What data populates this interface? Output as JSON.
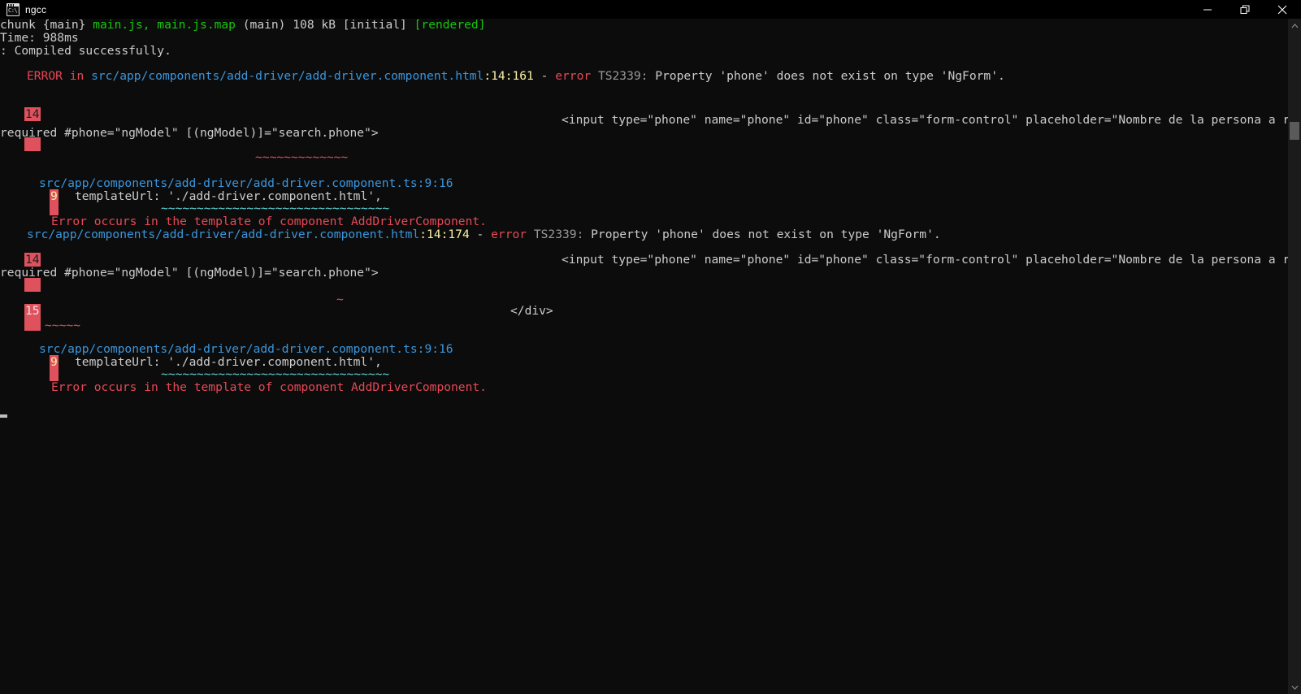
{
  "window": {
    "title": "ngcc",
    "icon": "console-window-icon",
    "controls": [
      {
        "name": "minimize-button",
        "glyph": "minimize"
      },
      {
        "name": "maximize-button",
        "glyph": "restore"
      },
      {
        "name": "close-button",
        "glyph": "close"
      }
    ]
  },
  "colors": {
    "background": "#0c0c0c",
    "titlebar": "#000000",
    "foreground": "#cccccc",
    "green": "#16c60c",
    "cyan": "#3a96dd",
    "teal": "#61d6d6",
    "red": "#e74856",
    "error_block": "#e0515e",
    "yellow": "#f9f1a5",
    "grey": "#9a9a9a",
    "scrollbar_track": "#1b1b1b",
    "scrollbar_thumb": "#5a5a5a"
  },
  "terminal": {
    "build_summary": {
      "chunk_label": "chunk {main} ",
      "chunk_files": "main.js, main.js.map",
      "chunk_meta": " (main) 108 kB [initial] ",
      "chunk_status": "[rendered]",
      "time_line": "Time: 988ms",
      "compiled_line": ": Compiled successfully."
    },
    "errors": [
      {
        "prefix": "ERROR",
        "in_word": " in ",
        "file": "src/app/components/add-driver/add-driver.component.html",
        "location": ":14:161",
        "dash": " - ",
        "error_word": "error",
        "code": " TS2339:",
        "message": " Property 'phone' does not exist on type 'NgForm'.",
        "source_line_number": "14",
        "source_code_left": "required #phone=\"ngModel\" [(ngModel)]=\"search.phone\">",
        "source_code_right": "<input type=\"phone\" name=\"phone\" id=\"phone\" class=\"form-control\" placeholder=\"Nombre de la persona a recoger\"",
        "squiggle": "~~~~~~~~~~~~~",
        "trace_file": "src/app/components/add-driver/add-driver.component.ts:9:16",
        "trace_line_number": "9",
        "trace_code": "templateUrl: './add-driver.component.html',",
        "trace_squiggle": "~~~~~~~~~~~~~~~~~~~~~~~~~~~~~~~~",
        "trace_note": "Error occurs in the template of component AddDriverComponent."
      },
      {
        "prefix": "",
        "in_word": "",
        "file": "src/app/components/add-driver/add-driver.component.html",
        "location": ":14:174",
        "dash": " - ",
        "error_word": "error",
        "code": " TS2339:",
        "message": " Property 'phone' does not exist on type 'NgForm'.",
        "source_line_number": "14",
        "source_code_left": "required #phone=\"ngModel\" [(ngModel)]=\"search.phone\">",
        "source_code_right": "<input type=\"phone\" name=\"phone\" id=\"phone\" class=\"form-control\" placeholder=\"Nombre de la persona a recoger\"",
        "squiggle": "~",
        "second_line_number": "15",
        "second_line_code": "</div>",
        "second_squiggle": "~~~~~",
        "trace_file": "src/app/components/add-driver/add-driver.component.ts:9:16",
        "trace_line_number": "9",
        "trace_code": "templateUrl: './add-driver.component.html',",
        "trace_squiggle": "~~~~~~~~~~~~~~~~~~~~~~~~~~~~~~~~",
        "trace_note": "Error occurs in the template of component AddDriverComponent."
      }
    ]
  },
  "scrollbar": {
    "up_arrow": "scroll-up-arrow",
    "down_arrow": "scroll-down-arrow",
    "thumb": "scroll-thumb"
  }
}
